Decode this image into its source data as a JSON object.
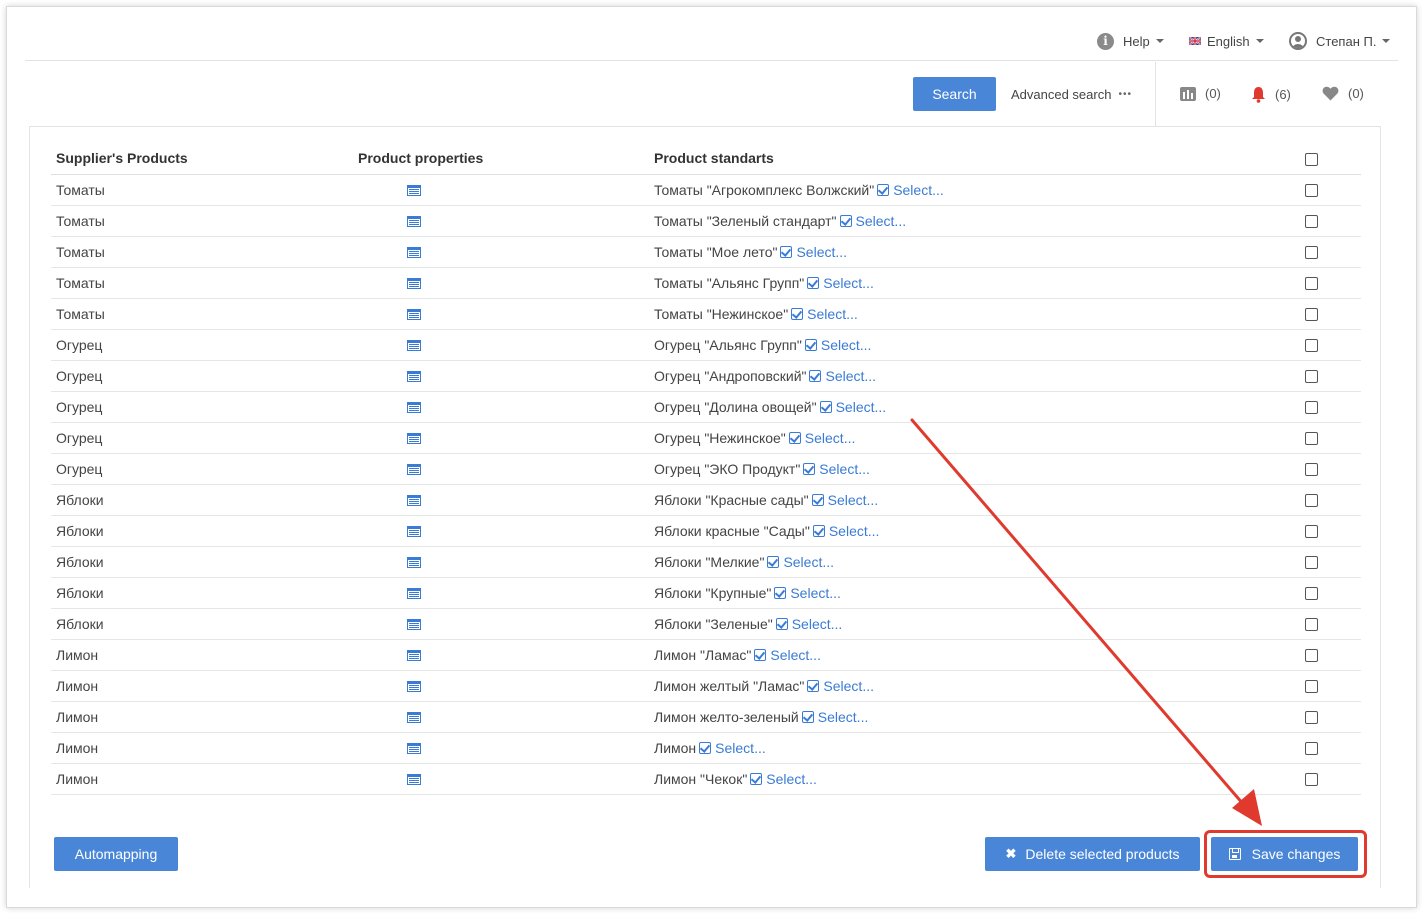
{
  "header": {
    "help_label": "Help",
    "language_label": "English",
    "user_label": "Степан П."
  },
  "toolbar": {
    "search_label": "Search",
    "advanced_search_label": "Advanced search",
    "advanced_search_dots": "•••",
    "compare_count": "(0)",
    "notifications_count": "(6)",
    "favorites_count": "(0)"
  },
  "table": {
    "columns": [
      "Supplier's Products",
      "Product properties",
      "Product standarts",
      ""
    ],
    "select_label": "Select...",
    "rows": [
      {
        "product": "Томаты",
        "standard": "Томаты \"Агрокомплекс Волжский\""
      },
      {
        "product": "Томаты",
        "standard": "Томаты \"Зеленый стандарт\""
      },
      {
        "product": "Томаты",
        "standard": "Томаты \"Мое лето\""
      },
      {
        "product": "Томаты",
        "standard": "Томаты \"Альянс Групп\""
      },
      {
        "product": "Томаты",
        "standard": "Томаты \"Нежинское\""
      },
      {
        "product": "Огурец",
        "standard": "Огурец \"Альянс Групп\""
      },
      {
        "product": "Огурец",
        "standard": "Огурец \"Андроповский\""
      },
      {
        "product": "Огурец",
        "standard": "Огурец \"Долина овощей\""
      },
      {
        "product": "Огурец",
        "standard": "Огурец \"Нежинское\""
      },
      {
        "product": "Огурец",
        "standard": "Огурец \"ЭКО Продукт\""
      },
      {
        "product": "Яблоки",
        "standard": "Яблоки \"Красные сады\""
      },
      {
        "product": "Яблоки",
        "standard": "Яблоки красные \"Сады\""
      },
      {
        "product": "Яблоки",
        "standard": "Яблоки \"Мелкие\""
      },
      {
        "product": "Яблоки",
        "standard": "Яблоки \"Крупные\""
      },
      {
        "product": "Яблоки",
        "standard": "Яблоки \"Зеленые\""
      },
      {
        "product": "Лимон",
        "standard": "Лимон \"Ламас\""
      },
      {
        "product": "Лимон",
        "standard": "Лимон желтый \"Ламас\""
      },
      {
        "product": "Лимон",
        "standard": "Лимон желто-зеленый"
      },
      {
        "product": "Лимон",
        "standard": "Лимон"
      },
      {
        "product": "Лимон",
        "standard": "Лимон \"Чекок\""
      }
    ]
  },
  "actions": {
    "automapping_label": "Automapping",
    "delete_label": "Delete selected products",
    "save_label": "Save changes"
  },
  "colors": {
    "primary": "#4a86d8",
    "link": "#3a7bd5",
    "highlight": "#e03a2f",
    "notification": "#e03a2f"
  }
}
